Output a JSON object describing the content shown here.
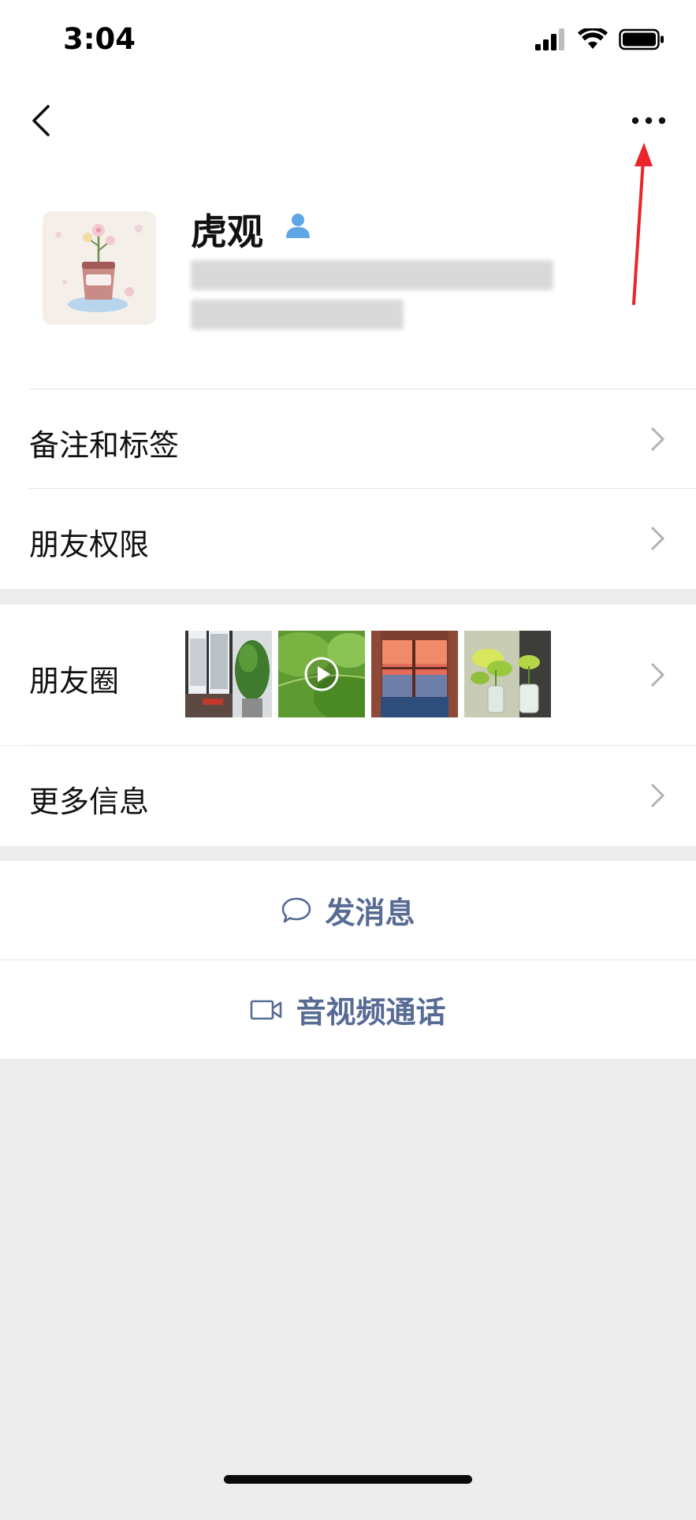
{
  "status_bar": {
    "time": "3:04"
  },
  "profile": {
    "name": "虎观"
  },
  "menu": {
    "remark_tags": "备注和标签",
    "friend_permissions": "朋友权限",
    "moments": "朋友圈",
    "more_info": "更多信息"
  },
  "actions": {
    "send_message": "发消息",
    "video_call": "音视频通话"
  },
  "colors": {
    "link_blue": "#576b95",
    "annotation_red": "#e8262b",
    "gender_blue": "#5ea6e6"
  },
  "icons": [
    "back-arrow-icon",
    "more-dots-icon",
    "gender-male-icon",
    "chevron-right-icon",
    "chat-bubble-icon",
    "video-camera-icon",
    "play-icon"
  ]
}
